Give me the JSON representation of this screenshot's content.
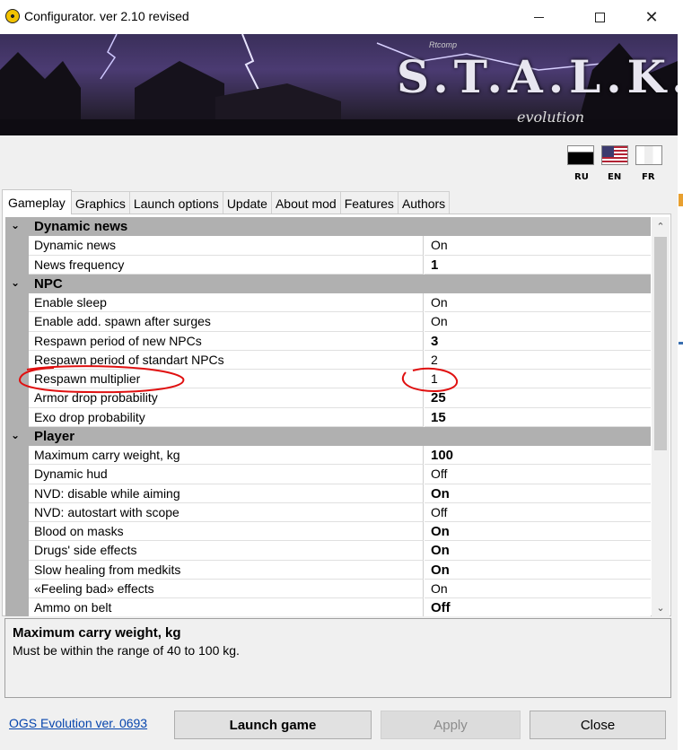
{
  "window": {
    "title": "Configurator. ver 2.10 revised",
    "min_glyph": "–",
    "max_glyph": "☐",
    "close_glyph": "✕"
  },
  "banner": {
    "logo_small": "Rtcomp",
    "logo": "S.T.A.L.K.E.R.",
    "logo_sub": "evolution"
  },
  "languages": [
    {
      "code": "RU"
    },
    {
      "code": "EN"
    },
    {
      "code": "FR"
    }
  ],
  "tabs": [
    "Gameplay",
    "Graphics",
    "Launch options",
    "Update",
    "About mod",
    "Features",
    "Authors"
  ],
  "grid": {
    "rows": [
      {
        "type": "cat",
        "name": "Dynamic news"
      },
      {
        "type": "prop",
        "name": "Dynamic news",
        "value": "On",
        "bold": false
      },
      {
        "type": "prop",
        "name": "News frequency",
        "value": "1",
        "bold": true
      },
      {
        "type": "cat",
        "name": "NPC"
      },
      {
        "type": "prop",
        "name": "Enable sleep",
        "value": "On",
        "bold": false
      },
      {
        "type": "prop",
        "name": "Enable add. spawn after surges",
        "value": "On",
        "bold": false
      },
      {
        "type": "prop",
        "name": "Respawn period of new NPCs",
        "value": "3",
        "bold": true
      },
      {
        "type": "prop",
        "name": "Respawn period of standart NPCs",
        "value": "2",
        "bold": false
      },
      {
        "type": "prop",
        "name": "Respawn multiplier",
        "value": "1",
        "bold": false
      },
      {
        "type": "prop",
        "name": "Armor drop probability",
        "value": "25",
        "bold": true
      },
      {
        "type": "prop",
        "name": "Exo drop probability",
        "value": "15",
        "bold": true
      },
      {
        "type": "cat",
        "name": "Player"
      },
      {
        "type": "prop",
        "name": "Maximum carry weight, kg",
        "value": "100",
        "bold": true
      },
      {
        "type": "prop",
        "name": "Dynamic hud",
        "value": "Off",
        "bold": false
      },
      {
        "type": "prop",
        "name": "NVD: disable while aiming",
        "value": "On",
        "bold": true
      },
      {
        "type": "prop",
        "name": "NVD: autostart with scope",
        "value": "Off",
        "bold": false
      },
      {
        "type": "prop",
        "name": "Blood on masks",
        "value": "On",
        "bold": true
      },
      {
        "type": "prop",
        "name": "Drugs' side effects",
        "value": "On",
        "bold": true
      },
      {
        "type": "prop",
        "name": "Slow healing from medkits",
        "value": "On",
        "bold": true
      },
      {
        "type": "prop",
        "name": "«Feeling bad» effects",
        "value": "On",
        "bold": false
      },
      {
        "type": "prop",
        "name": "Ammo on belt",
        "value": "Off",
        "bold": true
      }
    ]
  },
  "description": {
    "title": "Maximum carry weight, kg",
    "text": "Must be within the range of 40 to 100 kg."
  },
  "footer": {
    "link": "OGS Evolution ver. 0693",
    "launch": "Launch game",
    "apply": "Apply",
    "close": "Close"
  },
  "colors": {
    "category_bg": "#b0b0b0",
    "annotation": "#e01010",
    "link": "#0645ad"
  }
}
